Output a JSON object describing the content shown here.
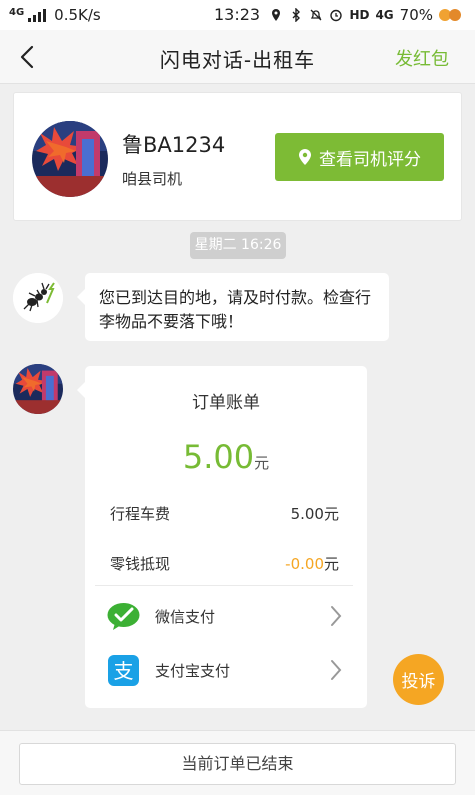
{
  "status_bar": {
    "network": "4G",
    "speed": "0.5K/s",
    "time": "13:23",
    "hd": "HD",
    "signal2": "4G",
    "battery": "70%"
  },
  "header": {
    "back_icon": "chevron-left-icon",
    "title": "闪电对话-出租车",
    "red_packet": "发红包"
  },
  "driver": {
    "plate": "鲁BA1234",
    "label": "咱县司机",
    "rating_button": "查看司机评分",
    "rating_icon": "location-pin-icon"
  },
  "chat": {
    "timestamp": "星期二 16:26",
    "arrival_message": "您已到达目的地，请及时付款。检查行李物品不要落下哦！"
  },
  "bill": {
    "title": "订单账单",
    "total": "5.00",
    "total_unit": "元",
    "rows": [
      {
        "label": "行程车费",
        "amount": "5.00",
        "unit": "元"
      },
      {
        "label": "零钱抵现",
        "amount": "-0.00",
        "unit": "元"
      }
    ],
    "payments": [
      {
        "label": "微信支付",
        "icon": "wechat-pay-icon"
      },
      {
        "label": "支付宝支付",
        "icon": "alipay-icon"
      }
    ]
  },
  "complain_button": "投诉",
  "footer": {
    "status": "当前订单已结束"
  },
  "colors": {
    "accent_green": "#7dbb35",
    "accent_orange": "#f5a623",
    "alipay_blue": "#1aa1e6",
    "wechat_green": "#3cb034"
  }
}
